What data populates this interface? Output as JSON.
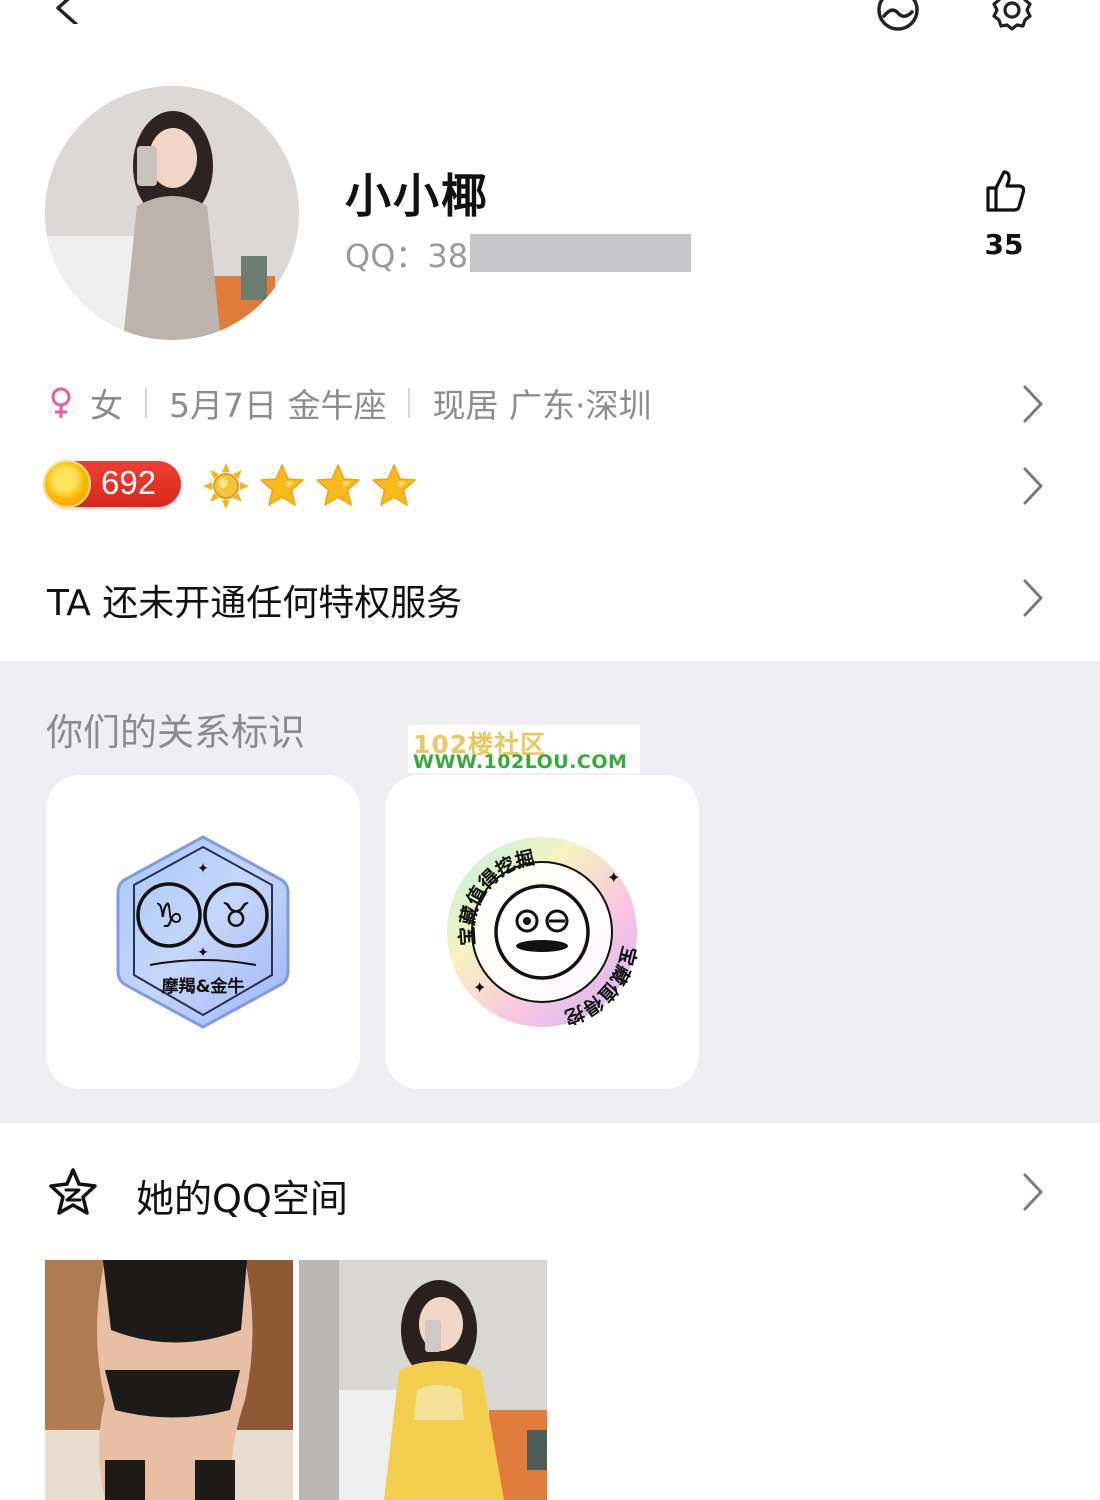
{
  "header": {
    "back_icon": "back-chevron-icon",
    "icons": [
      "theme-icon",
      "settings-gear-icon"
    ]
  },
  "profile": {
    "nickname": "小小椰",
    "qq_label": "QQ：",
    "qq_visible": "38",
    "likes": {
      "icon": "thumbs-up-icon",
      "count": "35"
    }
  },
  "info": {
    "gender_icon": "female-icon",
    "gender": "女",
    "birthday": "5月7日 金牛座",
    "location": "现居 广东·深圳"
  },
  "level": {
    "value": "692",
    "icons": [
      "sun-icon",
      "star-icon",
      "star-icon",
      "star-icon"
    ]
  },
  "privilege": {
    "text": "TA 还未开通任何特权服务"
  },
  "relationship": {
    "title": "你们的关系标识",
    "badges": [
      {
        "name": "zodiac-badge",
        "label": "摩羯&金牛"
      },
      {
        "name": "treasure-badge",
        "label": "宝藏值得挖掘"
      }
    ]
  },
  "watermark": {
    "line1": "102楼社区",
    "line2": "WWW.102LOU.COM"
  },
  "qzone": {
    "icon": "qzone-star-icon",
    "title": "她的QQ空间"
  },
  "colors": {
    "female": "#f05a9b",
    "badge_red": "#e32b22",
    "section_bg": "#efeff3",
    "muted": "#8d8d8d"
  }
}
